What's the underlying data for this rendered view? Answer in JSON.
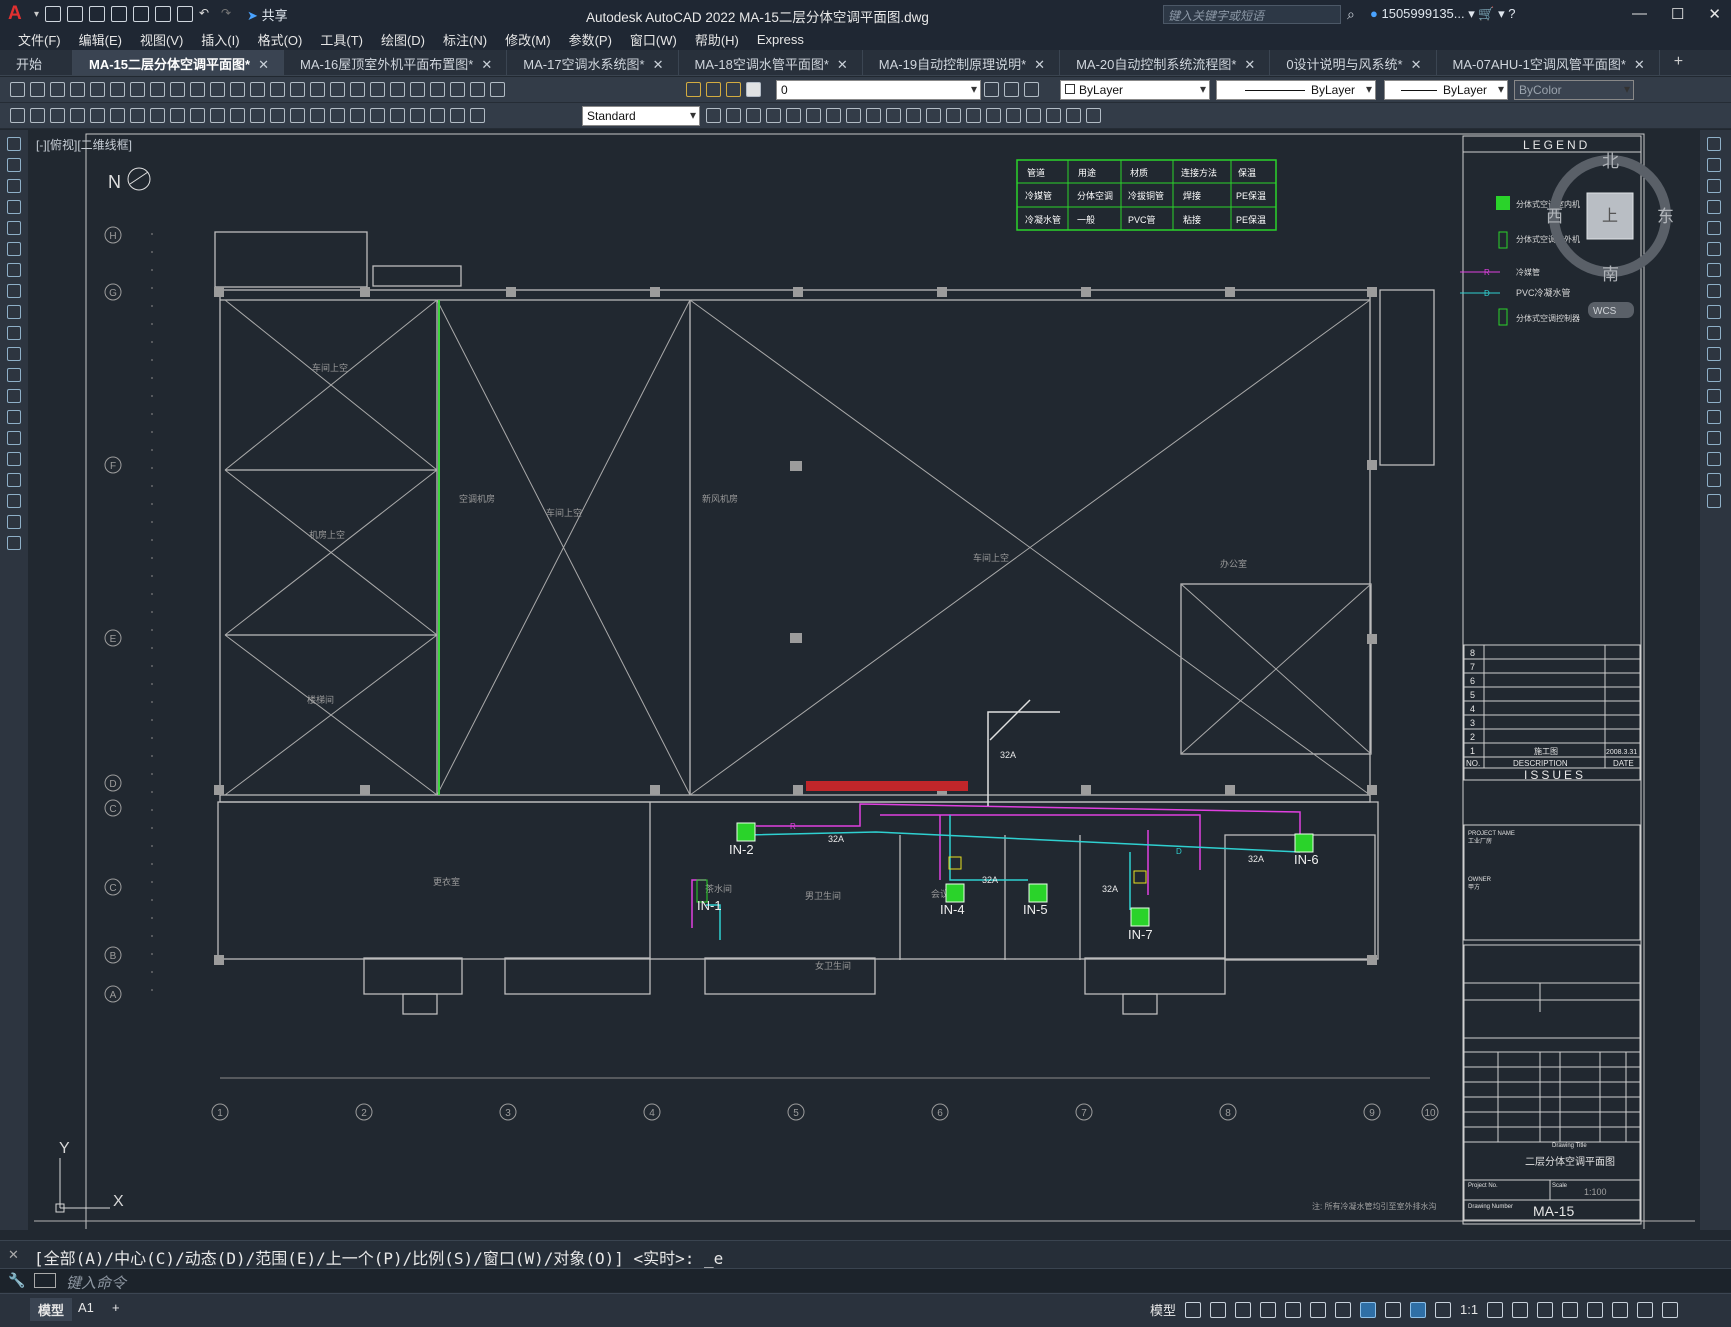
{
  "app": {
    "title": "Autodesk AutoCAD 2022    MA-15二层分体空调平面图.dwg",
    "logo": "A",
    "share": "共享",
    "search_placeholder": "键入关键字或短语",
    "user": "1505999135...",
    "window_buttons": [
      "—",
      "☐",
      "✕"
    ]
  },
  "menu": [
    "文件(F)",
    "编辑(E)",
    "视图(V)",
    "插入(I)",
    "格式(O)",
    "工具(T)",
    "绘图(D)",
    "标注(N)",
    "修改(M)",
    "参数(P)",
    "窗口(W)",
    "帮助(H)",
    "Express"
  ],
  "tabs": [
    {
      "label": "开始",
      "close": false
    },
    {
      "label": "MA-15二层分体空调平面图*",
      "active": true
    },
    {
      "label": "MA-16屋顶室外机平面布置图*"
    },
    {
      "label": "MA-17空调水系统图*"
    },
    {
      "label": "MA-18空调水管平面图*"
    },
    {
      "label": "MA-19自动控制原理说明*"
    },
    {
      "label": "MA-20自动控制系统流程图*"
    },
    {
      "label": "0设计说明与风系统*"
    },
    {
      "label": "MA-07AHU-1空调风管平面图*"
    }
  ],
  "toolbar": {
    "layer": "0",
    "color": "ByLayer",
    "linetype": "ByLayer",
    "lineweight": "ByLayer",
    "plotstyle": "ByColor",
    "textstyle": "Standard"
  },
  "viewport": {
    "label": "[-][俯视][二维线框]",
    "viewcube": {
      "n": "北",
      "s": "南",
      "e": "东",
      "w": "西",
      "top": "上",
      "wcs": "WCS"
    }
  },
  "drawing": {
    "north": "N",
    "grid_rows": [
      "H",
      "G",
      "F",
      "E",
      "D",
      "C",
      "C",
      "B",
      "A"
    ],
    "grid_cols": [
      "1",
      "2",
      "3",
      "4",
      "5",
      "6",
      "7",
      "8",
      "9",
      "10"
    ],
    "rooms": [
      "车间上空",
      "车间上空",
      "机房上空",
      "楼梯间",
      "车间上空",
      "空调机房",
      "新风机房",
      "会议室",
      "茶水间",
      "男卫生间",
      "女卫生间",
      "办公室",
      "更衣室"
    ],
    "units": [
      "IN-1",
      "IN-2",
      "IN-4",
      "IN-5",
      "IN-6",
      "IN-7"
    ],
    "sizes": [
      "32A",
      "32A",
      "32A",
      "32A",
      "32A"
    ],
    "pipe_labels": [
      "R",
      "D",
      "R",
      "D"
    ],
    "spec_table": [
      [
        "管道",
        "用途",
        "材质",
        "连接方法",
        "保温"
      ],
      [
        "冷媒管",
        "分体空调",
        "冷拔铜管",
        "焊接",
        "PE保温"
      ],
      [
        "冷凝水管",
        "一般",
        "PVC管",
        "粘接",
        "PE保温"
      ]
    ],
    "legend": {
      "title": "LEGEND",
      "items": [
        "分体式空调室内机",
        "分体式空调室外机",
        "冷媒管",
        "PVC冷凝水管",
        "分体式空调控制器"
      ]
    },
    "issues": {
      "title": "ISSUES",
      "rows": [
        "8",
        "7",
        "6",
        "5",
        "4",
        "3",
        "2",
        "1"
      ],
      "row1_desc": "施工图",
      "row1_date": "2008.3.31",
      "cols": [
        "NO.",
        "DESCRIPTION",
        "DATE"
      ]
    },
    "titleblock": {
      "project_name": "PROJECT NAME",
      "project_val": "工业厂房",
      "owner": "OWNER",
      "owner_val": "甲方",
      "drawing_title_label": "Drawing Title",
      "drawing_title": "二层分体空调平面图",
      "scale_label": "Scale",
      "scale": "1:100",
      "project_no": "Project No.",
      "drawing_no_label": "Drawing Number",
      "drawing_no": "MA-15"
    },
    "note": "注: 所有冷凝水管均引至室外排水沟"
  },
  "command": {
    "history": "[全部(A)/中心(C)/动态(D)/范围(E)/上一个(P)/比例(S)/窗口(W)/对象(O)] <实时>: _e",
    "placeholder": "键入命令"
  },
  "status": {
    "tabs": [
      "模型",
      "A1",
      "+"
    ],
    "model_label": "模型",
    "scale": "1:1"
  }
}
